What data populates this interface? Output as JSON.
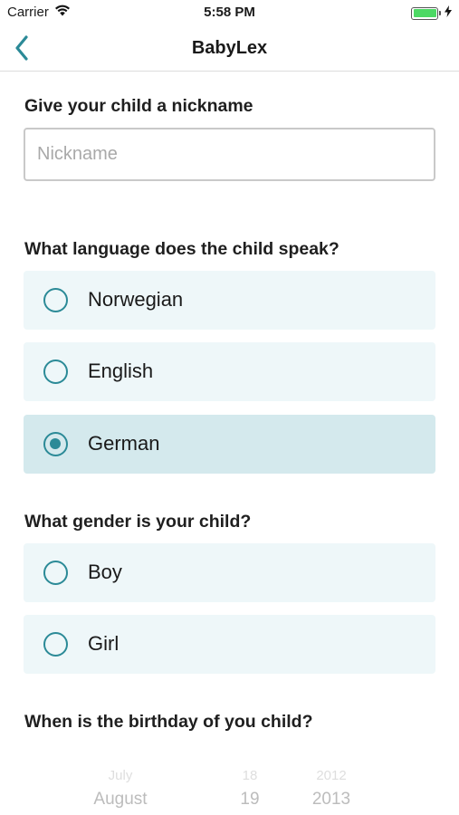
{
  "status_bar": {
    "carrier": "Carrier",
    "time": "5:58 PM",
    "battery_level": 1.0
  },
  "nav": {
    "title": "BabyLex",
    "back_icon": "chevron-left-icon"
  },
  "nickname_section": {
    "label": "Give your child a nickname",
    "placeholder": "Nickname",
    "value": ""
  },
  "language_section": {
    "label": "What language does the child speak?",
    "options": [
      {
        "label": "Norwegian",
        "selected": false
      },
      {
        "label": "English",
        "selected": false
      },
      {
        "label": "German",
        "selected": true
      }
    ]
  },
  "gender_section": {
    "label": "What gender is your child?",
    "options": [
      {
        "label": "Boy",
        "selected": false
      },
      {
        "label": "Girl",
        "selected": false
      }
    ]
  },
  "birthday_section": {
    "label": "When is the birthday of you child?",
    "picker": {
      "rows": [
        {
          "month": "July",
          "day": "18",
          "year": "2012"
        },
        {
          "month": "August",
          "day": "19",
          "year": "2013"
        }
      ]
    }
  },
  "colors": {
    "accent": "#2b8a97",
    "option_bg": "#eef7f9",
    "option_selected_bg": "#d4e9ed",
    "battery": "#4cd964"
  }
}
